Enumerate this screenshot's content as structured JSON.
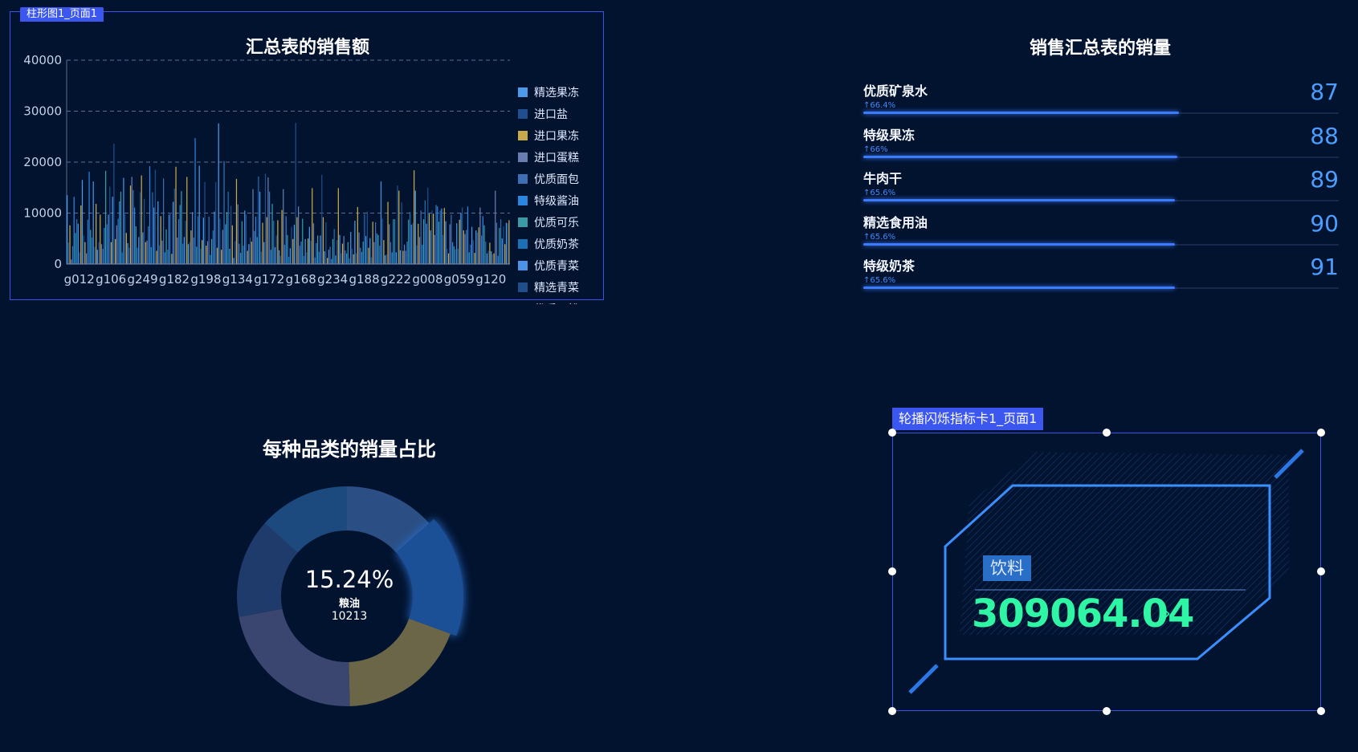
{
  "bar_chart": {
    "tag": "柱形图1_页面1",
    "colors": [
      "#4c9bea",
      "#1f4f8e",
      "#c9aa4a",
      "#6a7db0",
      "#3e6fb5",
      "#2a86e0",
      "#3a9aa5",
      "#1d6fb6",
      "#4b93e8",
      "#1e4f8a",
      "#c9aa4a"
    ]
  },
  "chart_data": [
    {
      "type": "bar",
      "title": "汇总表的销售额",
      "ylim": [
        0,
        40000
      ],
      "yticks": [
        0,
        10000,
        20000,
        30000,
        40000
      ],
      "xtick_labels": [
        "g012",
        "g106",
        "g249",
        "g182",
        "g198",
        "g134",
        "g172",
        "g168",
        "g234",
        "g188",
        "g222",
        "g008",
        "g059",
        "g120"
      ],
      "legend": [
        "精选果冻",
        "进口盐",
        "进口果冻",
        "进口蛋糕",
        "优质面包",
        "特级酱油",
        "优质可乐",
        "优质奶茶",
        "优质青菜",
        "精选青菜",
        "优质面粉"
      ],
      "legend_position": "right",
      "grid": true,
      "values": [
        13500,
        4200,
        7600,
        900,
        3500,
        13200,
        6100,
        8800,
        7900,
        2300,
        11500,
        16500,
        5600,
        4300,
        2100,
        8700,
        18100,
        6700,
        5200,
        16200,
        3400,
        11800,
        2800,
        4300,
        9700,
        3900,
        3000,
        7100,
        18300,
        7800,
        9700,
        15200,
        4300,
        13200,
        23600,
        4900,
        7600,
        8900,
        12300,
        14200,
        2300,
        16900,
        9800,
        6100,
        4100,
        3200,
        15400,
        17100,
        14500,
        11100,
        7400,
        3200,
        5300,
        14100,
        17400,
        6200,
        12800,
        4300,
        4600,
        7400,
        19200,
        3300,
        14100,
        11100,
        18500,
        2600,
        12300,
        3700,
        9400,
        4600,
        16800,
        2300,
        6800,
        2800,
        9700,
        10100,
        2000,
        12200,
        14800,
        19100,
        5200,
        8800,
        11600,
        14300,
        4000,
        5300,
        8500,
        17100,
        3900,
        4300,
        6600,
        10200,
        5200,
        24700,
        3400,
        9400,
        19300,
        3000,
        4700,
        9100,
        16100,
        3600,
        4500,
        9300,
        1800,
        4900,
        6600,
        10300,
        16100,
        3200,
        27600,
        8900,
        2800,
        6700,
        20200,
        7800,
        10200,
        14200,
        3000,
        11400,
        7600,
        1200,
        4500,
        16700,
        11700,
        4000,
        2200,
        8400,
        3600,
        10500,
        9700,
        2600,
        3900,
        5200,
        4400,
        14700,
        6500,
        9300,
        5300,
        17200,
        14200,
        2400,
        8100,
        4300,
        17700,
        9200,
        17000,
        14200,
        2800,
        11800,
        8500,
        3300,
        5600,
        8600,
        2700,
        1600,
        10600,
        14700,
        3800,
        9400,
        5700,
        1400,
        3100,
        7300,
        4900,
        7700,
        27700,
        9200,
        11300,
        3600,
        4400,
        8900,
        1600,
        4900,
        2300,
        5000,
        7300,
        4600,
        14900,
        8000,
        1300,
        4100,
        5600,
        2400,
        5600,
        17500,
        9200,
        2500,
        8200,
        1200,
        2800,
        3400,
        1000,
        4900,
        6900,
        1700,
        4700,
        14900,
        5700,
        2100,
        4000,
        5500,
        2700,
        2100,
        4300,
        1100,
        6300,
        3000,
        1900,
        8500,
        2100,
        11200,
        6200,
        3200,
        2400,
        4400,
        9800,
        5500,
        10300,
        3200,
        5100,
        1300,
        8300,
        4300,
        8200,
        6000,
        5700,
        3600,
        16200,
        8900,
        4700,
        1700,
        1900,
        12200,
        7800,
        4300,
        2300,
        8800,
        8800,
        2300,
        15400,
        14400,
        2700,
        12100,
        2600,
        3800,
        2600,
        4400,
        8700,
        10200,
        7700,
        8000,
        18400,
        14400,
        3700,
        7900,
        5300,
        10500,
        3800,
        8800,
        12500,
        7900,
        15000,
        9900,
        6600,
        10500,
        9900,
        5700,
        11600,
        11300,
        8300,
        10500,
        10900,
        5700,
        11000,
        8400,
        3000,
        2100,
        7800,
        9700,
        4300,
        3500,
        2900,
        8000,
        3000,
        8700,
        10000,
        11100,
        6600,
        5900,
        6700,
        11300,
        2300,
        3800,
        7300,
        4700,
        2200,
        6600,
        6200,
        7200,
        11100,
        5600,
        9400,
        7600,
        4400,
        2100,
        2600,
        4200,
        2500,
        1900,
        2100,
        14400,
        8100,
        1600,
        7100,
        8800,
        5000,
        7400,
        3900,
        8100,
        8000,
        8600
      ]
    },
    {
      "type": "pie",
      "title": "每种品类的销量占比",
      "center_percent": "15.24%",
      "center_name": "粮油",
      "center_value": "10213",
      "slices": [
        {
          "value": 12,
          "color": "#2b4f84"
        },
        {
          "value": 15.24,
          "color": "#1b4f96",
          "highlight": true
        },
        {
          "value": 17,
          "color": "#6b6647"
        },
        {
          "value": 20,
          "color": "#3a4670"
        },
        {
          "value": 13,
          "color": "#1f3b6b"
        },
        {
          "value": 12,
          "color": "#1d4a7e"
        }
      ]
    }
  ],
  "rank": {
    "title": "销售汇总表的销量",
    "items": [
      {
        "name": "优质矿泉水",
        "pct": "66.4%",
        "fill": 0.664,
        "value": "87"
      },
      {
        "name": "特级果冻",
        "pct": "66%",
        "fill": 0.66,
        "value": "88"
      },
      {
        "name": "牛肉干",
        "pct": "65.6%",
        "fill": 0.656,
        "value": "89"
      },
      {
        "name": "精选食用油",
        "pct": "65.6%",
        "fill": 0.656,
        "value": "90"
      },
      {
        "name": "特级奶茶",
        "pct": "65.6%",
        "fill": 0.656,
        "value": "91"
      }
    ]
  },
  "kpi": {
    "tag": "轮播闪烁指标卡1_页面1",
    "label": "饮料",
    "value": "309064.04",
    "arrow": "›"
  }
}
